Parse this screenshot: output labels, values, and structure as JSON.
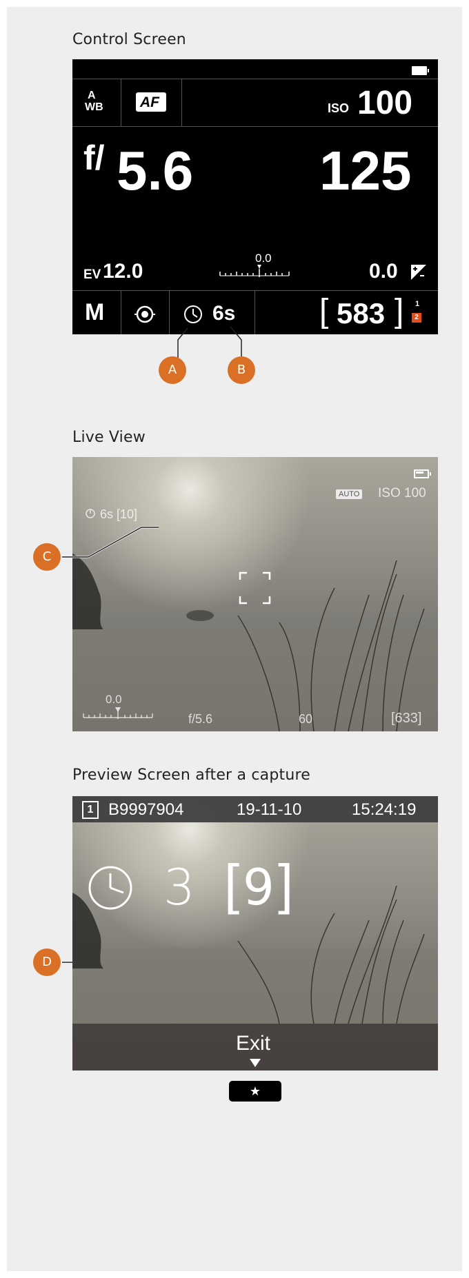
{
  "sections": {
    "control_title": "Control Screen",
    "live_title": "Live View",
    "preview_title": "Preview Screen after a capture"
  },
  "control": {
    "wb_top": "A",
    "wb_bottom": "WB",
    "af": "AF",
    "iso_label": "ISO",
    "iso_value": "100",
    "aperture_prefix": "f/",
    "aperture_value": "5.6",
    "shutter": "125",
    "ev_label": "EV",
    "ev_value": "12.0",
    "scale_value": "0.0",
    "comp_value": "0.0",
    "comp_icon": "exposure-compensation-icon",
    "mode": "M",
    "metering_icon": "metering-icon",
    "timer_icon": "self-timer-icon",
    "timer_value": "6s",
    "shots_open": "[",
    "shots": "583",
    "shots_close": "]",
    "card1": "1",
    "card2": "2",
    "accent": "#e24e1b"
  },
  "callouts": {
    "a": "A",
    "b": "B",
    "c": "C",
    "d": "D",
    "color": "#d97025"
  },
  "live": {
    "timer_text": "6s [10]",
    "auto": "AUTO",
    "iso": "ISO 100",
    "scale_value": "0.0",
    "aperture": "f/5.6",
    "shutter": "60",
    "shots": "[633]"
  },
  "preview": {
    "card": "1",
    "file": "B9997904",
    "date": "19-11-10",
    "time": "15:24:19",
    "timer_count": "3",
    "bracket_open": "[",
    "total": "9",
    "bracket_close": "]",
    "exit": "Exit",
    "star": "★"
  }
}
